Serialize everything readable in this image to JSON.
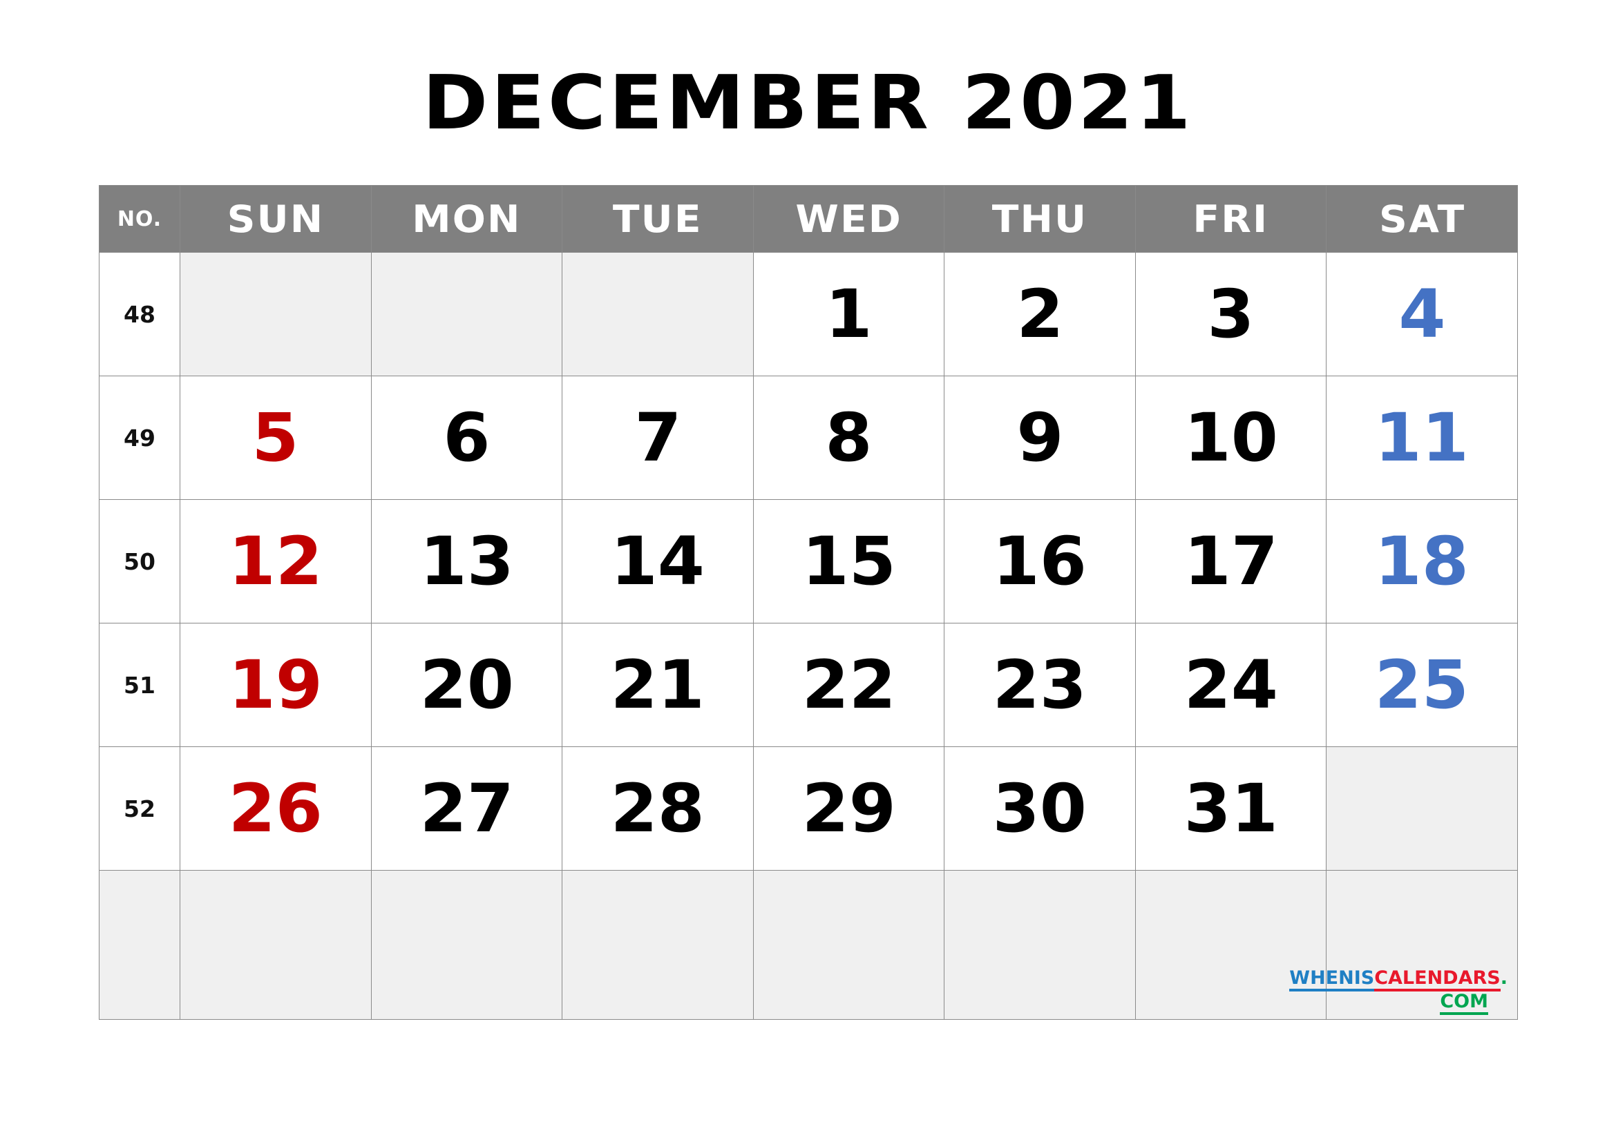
{
  "title": "DECEMBER 2021",
  "month": "DECEMBER",
  "year": "2021",
  "header": {
    "week_no_label": "NO.",
    "days": [
      "SUN",
      "MON",
      "TUE",
      "WED",
      "THU",
      "FRI",
      "SAT"
    ]
  },
  "colors": {
    "header_bg": "#808080",
    "header_text": "#ffffff",
    "empty_cell": "#f0f0f0",
    "grid_line": "#8a8a8a",
    "sunday": "#C00000",
    "saturday": "#4472C4",
    "weekday": "#000000",
    "watermark_blue": "#1F7FC4",
    "watermark_red": "#E8192C",
    "watermark_green": "#00A550"
  },
  "weeks": [
    {
      "no": "48",
      "days": [
        {
          "label": "",
          "type": "empty"
        },
        {
          "label": "",
          "type": "empty"
        },
        {
          "label": "",
          "type": "empty"
        },
        {
          "label": "1",
          "type": "weekday"
        },
        {
          "label": "2",
          "type": "weekday"
        },
        {
          "label": "3",
          "type": "weekday"
        },
        {
          "label": "4",
          "type": "saturday"
        }
      ]
    },
    {
      "no": "49",
      "days": [
        {
          "label": "5",
          "type": "sunday"
        },
        {
          "label": "6",
          "type": "weekday"
        },
        {
          "label": "7",
          "type": "weekday"
        },
        {
          "label": "8",
          "type": "weekday"
        },
        {
          "label": "9",
          "type": "weekday"
        },
        {
          "label": "10",
          "type": "weekday"
        },
        {
          "label": "11",
          "type": "saturday"
        }
      ]
    },
    {
      "no": "50",
      "days": [
        {
          "label": "12",
          "type": "sunday"
        },
        {
          "label": "13",
          "type": "weekday"
        },
        {
          "label": "14",
          "type": "weekday"
        },
        {
          "label": "15",
          "type": "weekday"
        },
        {
          "label": "16",
          "type": "weekday"
        },
        {
          "label": "17",
          "type": "weekday"
        },
        {
          "label": "18",
          "type": "saturday"
        }
      ]
    },
    {
      "no": "51",
      "days": [
        {
          "label": "19",
          "type": "sunday"
        },
        {
          "label": "20",
          "type": "weekday"
        },
        {
          "label": "21",
          "type": "weekday"
        },
        {
          "label": "22",
          "type": "weekday"
        },
        {
          "label": "23",
          "type": "weekday"
        },
        {
          "label": "24",
          "type": "weekday"
        },
        {
          "label": "25",
          "type": "saturday"
        }
      ]
    },
    {
      "no": "52",
      "days": [
        {
          "label": "26",
          "type": "sunday"
        },
        {
          "label": "27",
          "type": "weekday"
        },
        {
          "label": "28",
          "type": "weekday"
        },
        {
          "label": "29",
          "type": "weekday"
        },
        {
          "label": "30",
          "type": "weekday"
        },
        {
          "label": "31",
          "type": "weekday"
        },
        {
          "label": "",
          "type": "empty"
        }
      ]
    }
  ],
  "watermark": {
    "part1": "WHENIS",
    "part2": "CALENDARS",
    "dot": ".",
    "part3": "COM"
  }
}
